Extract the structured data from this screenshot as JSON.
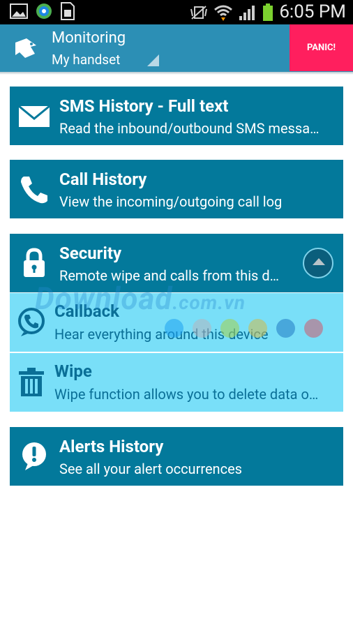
{
  "status_bar": {
    "time": "6:05 PM",
    "icons": [
      "image-icon",
      "sync-icon",
      "sim-card-icon",
      "vibrate-mute-icon",
      "wifi-icon",
      "signal-icon",
      "battery-icon"
    ]
  },
  "action_bar": {
    "title": "Monitoring",
    "subtitle": "My handset",
    "panic_label": "PANIC!"
  },
  "menu": {
    "sms": {
      "title": "SMS History - Full text",
      "desc": "Read the inbound/outbound SMS messa…"
    },
    "calls": {
      "title": "Call History",
      "desc": "View the incoming/outgoing call log"
    },
    "security": {
      "title": "Security",
      "desc": "Remote wipe and calls from this d…",
      "submenu": {
        "callback": {
          "title": "Callback",
          "desc": "Hear everything around this device"
        },
        "wipe": {
          "title": "Wipe",
          "desc": "Wipe function allows you to delete data o…"
        }
      }
    },
    "alerts": {
      "title": "Alerts History",
      "desc": "See all your alert occurrences"
    }
  },
  "watermark": {
    "text": "Download",
    "suffix": ".com.vn"
  },
  "colors": {
    "action_bar": "#2c8fb5",
    "panic": "#ff1f5e",
    "card": "#03799b",
    "submenu": "#79dff8",
    "submenu_text": "#0a6f97"
  }
}
